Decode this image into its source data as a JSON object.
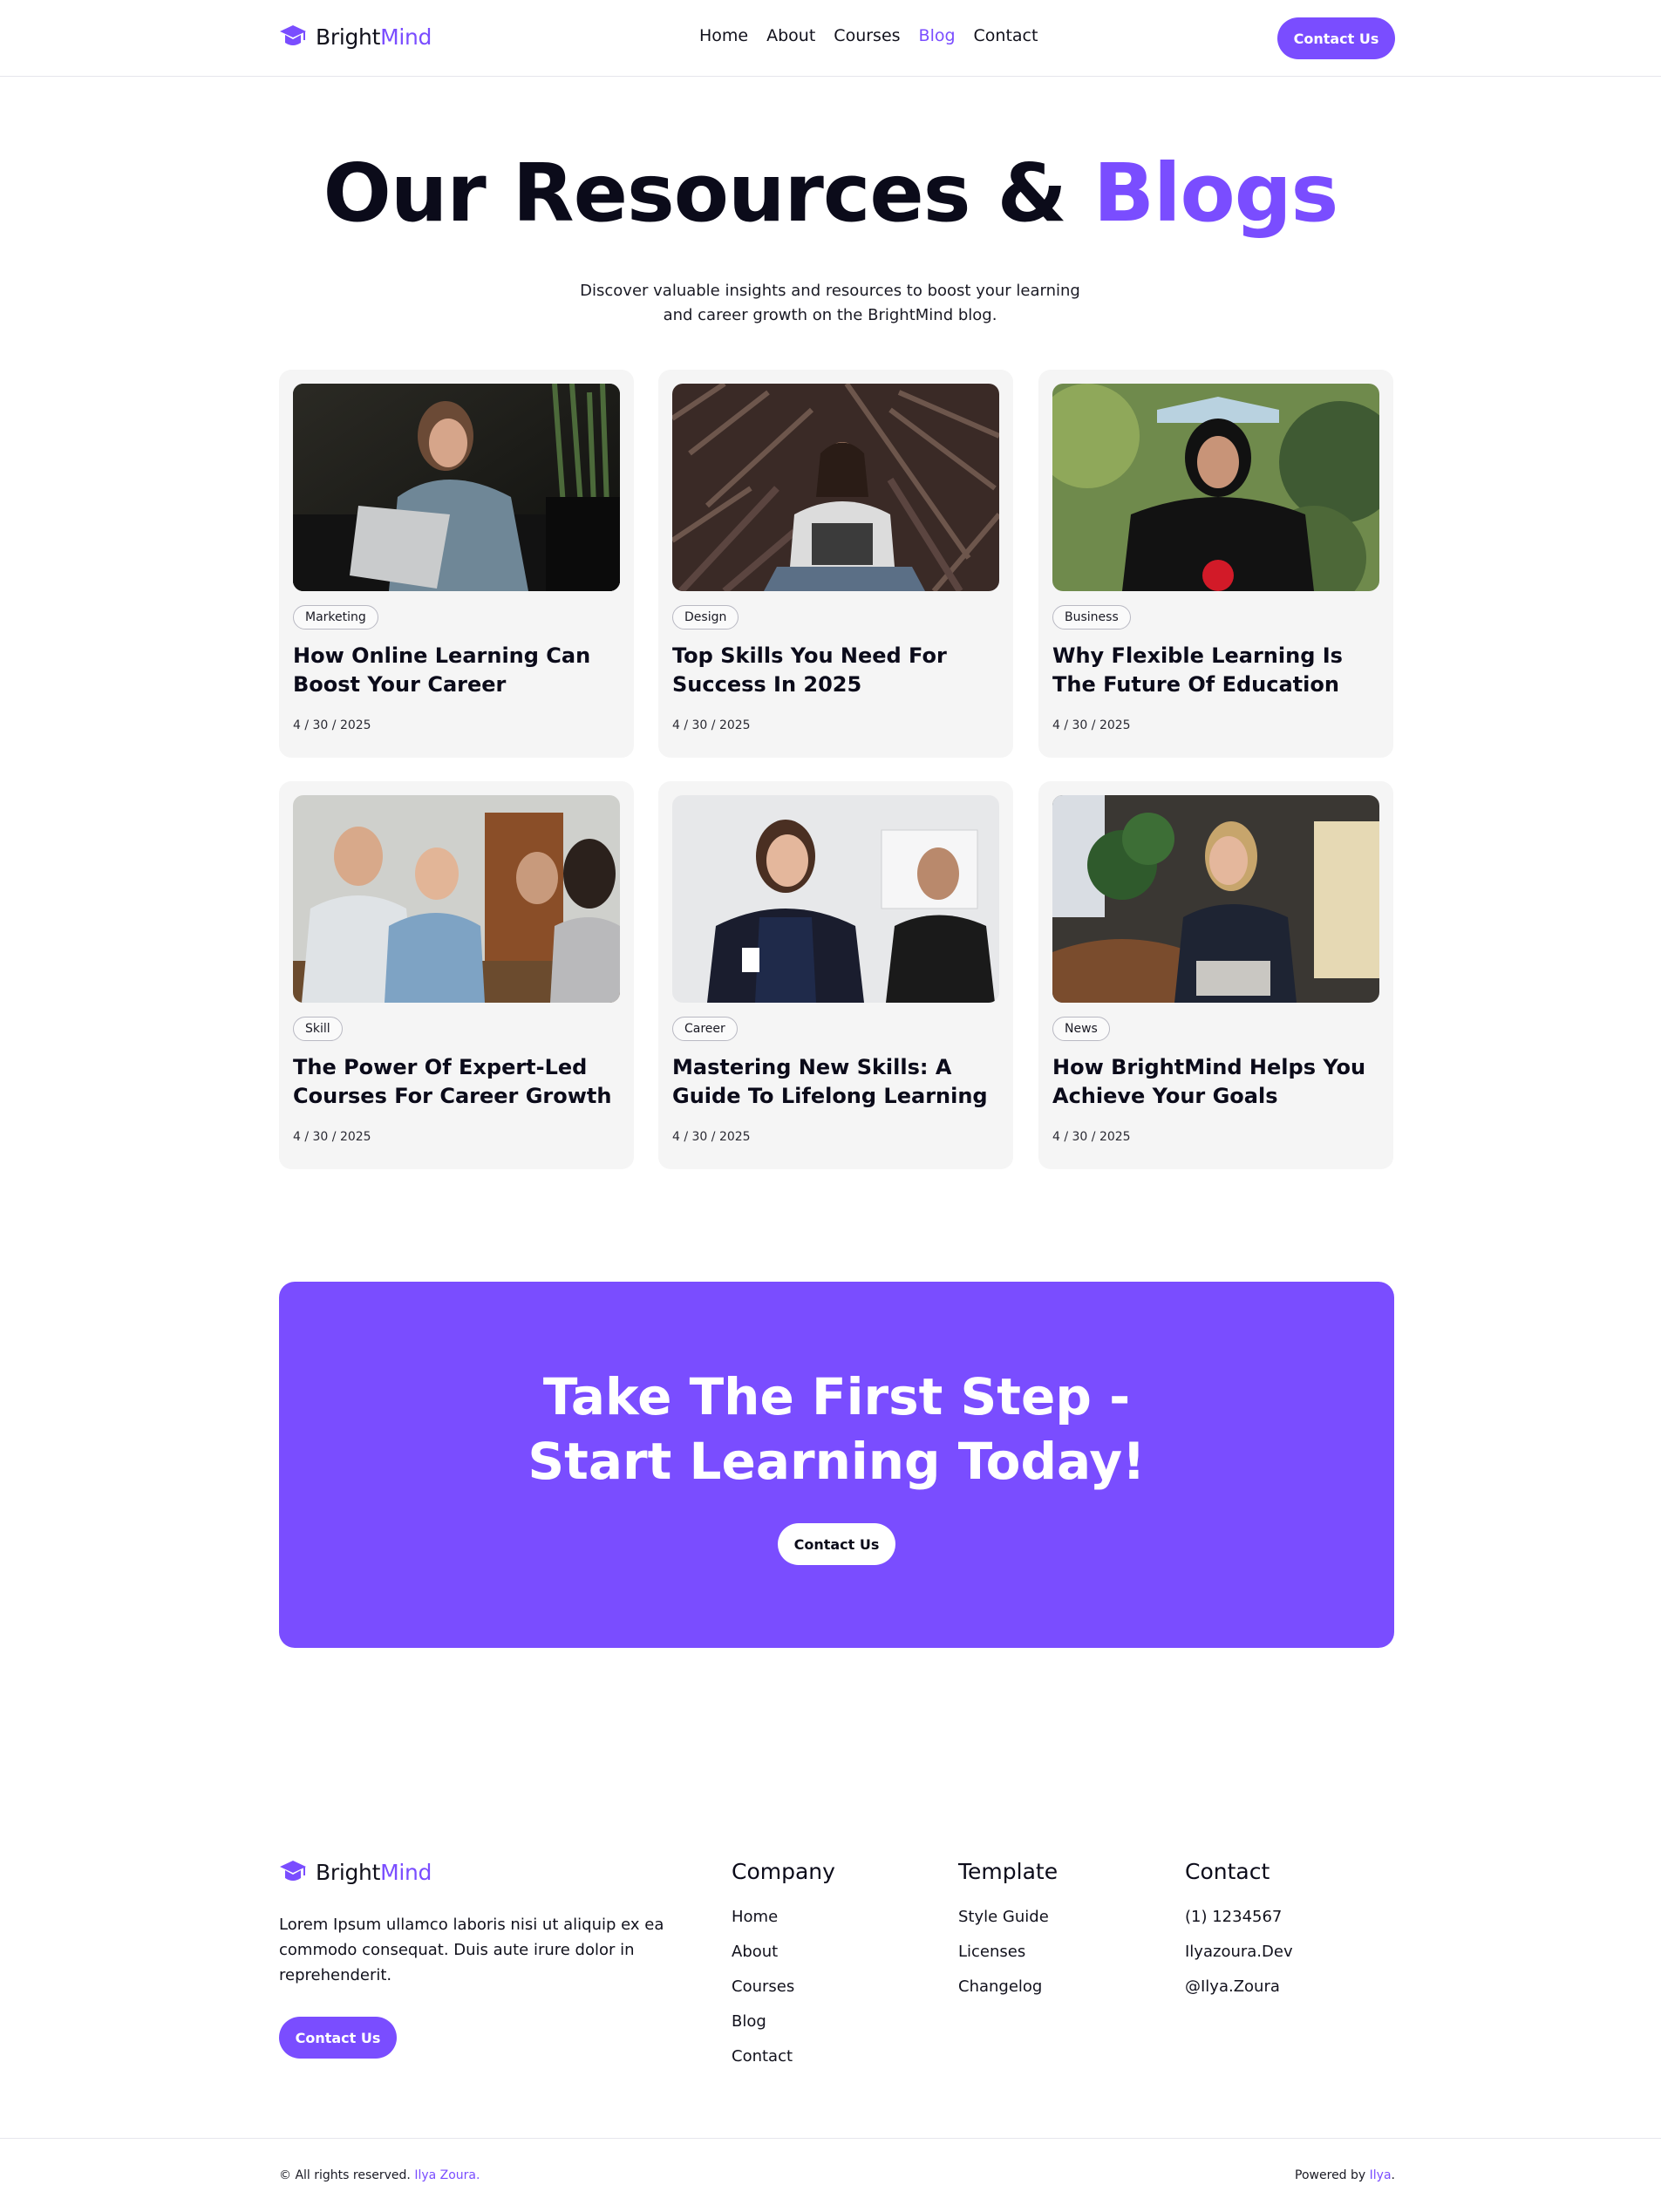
{
  "colors": {
    "accent": "#7a4dff",
    "text": "#0b0b1a",
    "card_bg": "#f5f5f5"
  },
  "brand": {
    "part1": "Bright",
    "part2": "Mind",
    "icon": "graduation-cap-icon"
  },
  "nav": {
    "links": [
      "Home",
      "About",
      "Courses",
      "Blog",
      "Contact"
    ],
    "active": "Blog",
    "cta_label": "Contact Us"
  },
  "hero": {
    "title_main": "Our Resources & ",
    "title_accent": "Blogs",
    "subtitle_line1": "Discover valuable insights and resources to boost your learning",
    "subtitle_line2": "and career growth on the BrightMind blog."
  },
  "posts": [
    {
      "tag": "Marketing",
      "title": "How Online Learning Can Boost Your Career",
      "date": "4 / 30 / 2025",
      "image": "woman-with-laptop-on-sofa"
    },
    {
      "tag": "Design",
      "title": "Top Skills You Need For Success In 2025",
      "date": "4 / 30 / 2025",
      "image": "woman-with-laptop-in-plants"
    },
    {
      "tag": "Business",
      "title": "Why Flexible Learning Is The Future Of Education",
      "date": "4 / 30 / 2025",
      "image": "woman-with-book-on-head"
    },
    {
      "tag": "Skill",
      "title": "The Power Of Expert-Led Courses For Career Growth",
      "date": "4 / 30 / 2025",
      "image": "group-studying-together"
    },
    {
      "tag": "Career",
      "title": "Mastering New Skills: A Guide To Lifelong Learning",
      "date": "4 / 30 / 2025",
      "image": "two-women-celebrating"
    },
    {
      "tag": "News",
      "title": "How BrightMind Helps You Achieve Your Goals",
      "date": "4 / 30 / 2025",
      "image": "woman-on-phone-with-laptop"
    }
  ],
  "cta": {
    "title_line1": "Take The First Step -",
    "title_line2": "Start Learning Today!",
    "button_label": "Contact Us"
  },
  "footer": {
    "description": "Lorem Ipsum ullamco laboris nisi ut aliquip ex ea commodo consequat. Duis aute irure dolor in reprehenderit.",
    "button_label": "Contact Us",
    "columns": [
      {
        "heading": "Company",
        "links": [
          "Home",
          "About",
          "Courses",
          "Blog",
          "Contact"
        ]
      },
      {
        "heading": "Template",
        "links": [
          "Style Guide",
          "Licenses",
          "Changelog"
        ]
      },
      {
        "heading": "Contact",
        "links": [
          "(1) 1234567",
          "Ilyazoura.Dev",
          "@Ilya.Zoura"
        ]
      }
    ],
    "copyright_text": "© All rights reserved.",
    "copyright_link": "Ilya Zoura.",
    "powered_text": "Powered by",
    "powered_link": "Ilya",
    "powered_end": "."
  }
}
